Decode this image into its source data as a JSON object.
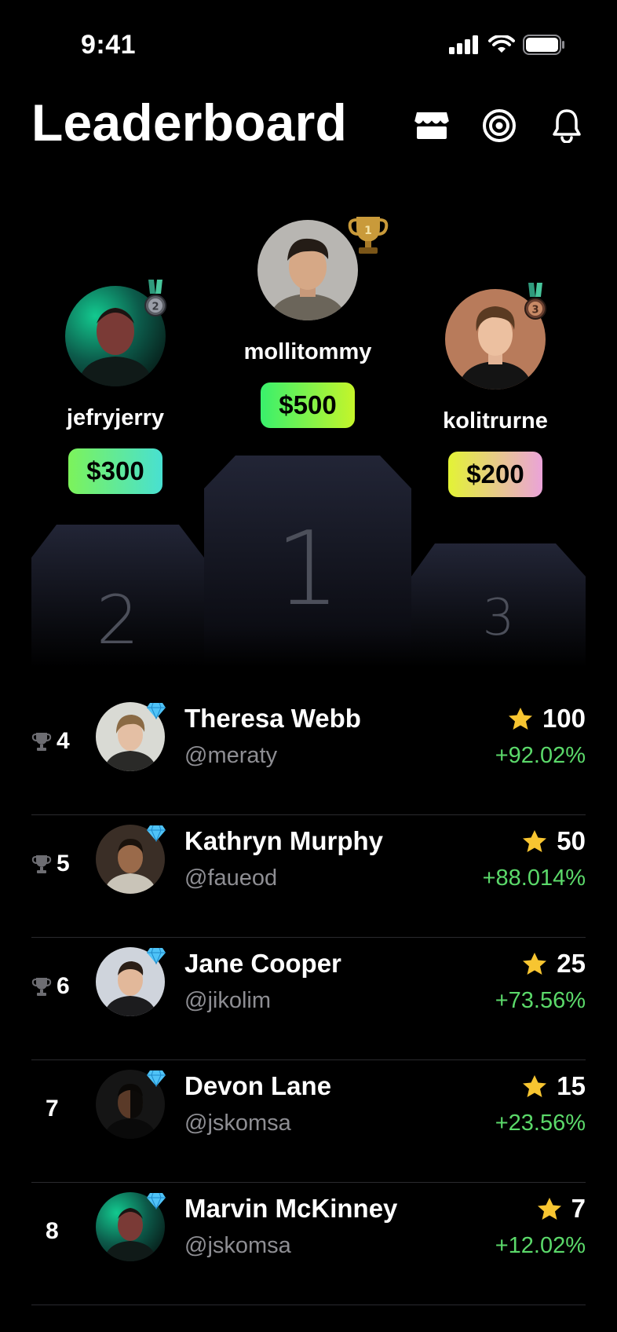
{
  "status_bar": {
    "time": "9:41"
  },
  "header": {
    "title": "Leaderboard",
    "icons": [
      "store-icon",
      "target-icon",
      "bell-icon"
    ]
  },
  "podium": {
    "first": {
      "rank": "1",
      "name": "mollitommy",
      "prize": "$500",
      "medal": "trophy-icon"
    },
    "second": {
      "rank": "2",
      "name": "jefryjerry",
      "prize": "$300",
      "medal": "silver-medal-icon"
    },
    "third": {
      "rank": "3",
      "name": "kolitrurne",
      "prize": "$200",
      "medal": "bronze-medal-icon"
    }
  },
  "rankings": [
    {
      "rank": "4",
      "name": "Theresa Webb",
      "handle": "@meraty",
      "score": "100",
      "change": "+92.02%",
      "trophy": true
    },
    {
      "rank": "5",
      "name": "Kathryn Murphy",
      "handle": "@faueod",
      "score": "50",
      "change": "+88.014%",
      "trophy": true
    },
    {
      "rank": "6",
      "name": "Jane Cooper",
      "handle": "@jikolim",
      "score": "25",
      "change": "+73.56%",
      "trophy": true
    },
    {
      "rank": "7",
      "name": "Devon Lane",
      "handle": "@jskomsa",
      "score": "15",
      "change": "+23.56%",
      "trophy": false
    },
    {
      "rank": "8",
      "name": "Marvin McKinney",
      "handle": "@jskomsa",
      "score": "7",
      "change": "+12.02%",
      "trophy": false
    }
  ],
  "colors": {
    "background": "#000000",
    "accent_green": "#5bd96a",
    "podium": "#1c1e29",
    "star": "#f7c531",
    "diamond": "#4fc3f7"
  }
}
